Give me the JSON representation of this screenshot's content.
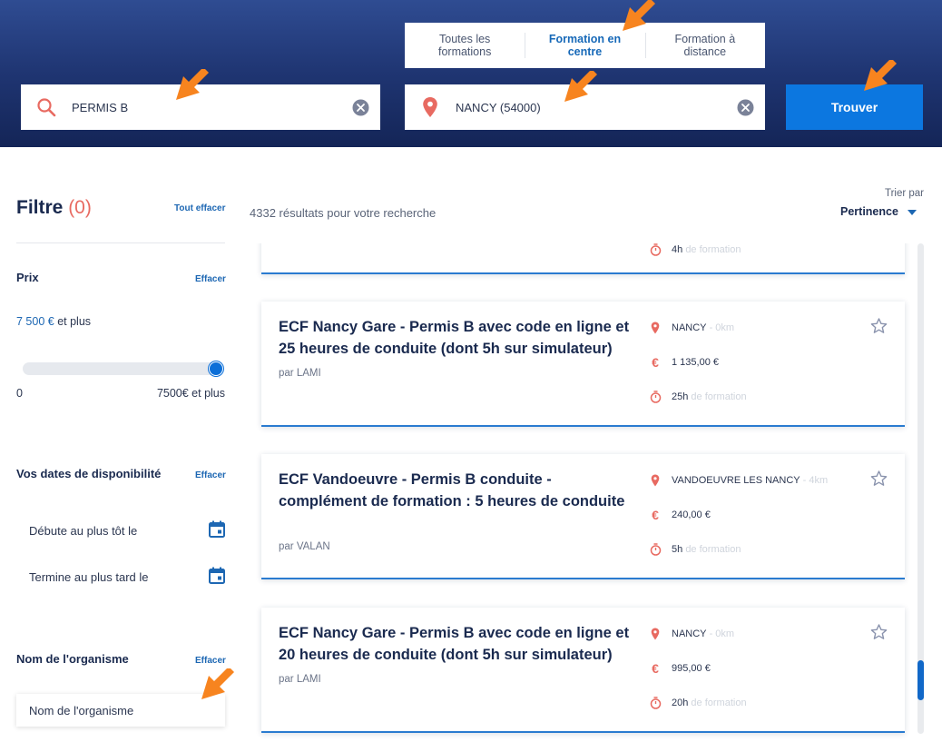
{
  "header": {
    "mode_tabs": [
      {
        "label": "Toutes les formations",
        "active": false
      },
      {
        "label": "Formation en centre",
        "active": true
      },
      {
        "label": "Formation à distance",
        "active": false
      }
    ],
    "search": {
      "value": "PERMIS B",
      "icon": "search-icon"
    },
    "location": {
      "value": "NANCY (54000)",
      "icon": "map-pin-icon"
    },
    "find_label": "Trouver"
  },
  "sidebar": {
    "filter_title": "Filtre",
    "filter_count": "(0)",
    "clear_all_label": "Tout effacer",
    "price": {
      "title": "Prix",
      "clear_label": "Effacer",
      "value_num": "7 500 €",
      "value_suffix": " et plus",
      "slider_min": "0",
      "slider_max": "7500€ et plus",
      "slider_position": 1.0
    },
    "dates": {
      "title": "Vos dates de disponibilité",
      "clear_label": "Effacer",
      "start_label": "Débute au plus tôt le",
      "end_label": "Termine au plus tard le"
    },
    "org": {
      "title": "Nom de l'organisme",
      "clear_label": "Effacer",
      "placeholder": "Nom de l'organisme"
    }
  },
  "results": {
    "count_text": "4332 résultats pour votre recherche",
    "sort_label": "Trier par",
    "sort_value": "Pertinence",
    "partial_card": {
      "duration": "4h",
      "duration_suffix": "de formation"
    },
    "cards": [
      {
        "title": "ECF Nancy Gare - Permis B avec code en ligne et 25 heures de conduite (dont 5h sur simulateur)",
        "org": "par LAMI",
        "location": "NANCY",
        "distance": "- 0km",
        "price": "1 135,00 €",
        "duration": "25h",
        "duration_suffix": "de formation"
      },
      {
        "title": "ECF Vandoeuvre - Permis B conduite - complément de formation : 5 heures de conduite",
        "org": "par VALAN",
        "location": "VANDOEUVRE LES NANCY",
        "distance": "- 4km",
        "price": "240,00 €",
        "duration": "5h",
        "duration_suffix": "de formation"
      },
      {
        "title": "ECF Nancy Gare - Permis B avec code en ligne et 20 heures de conduite (dont 5h sur simulateur)",
        "org": "par LAMI",
        "location": "NANCY",
        "distance": "- 0km",
        "price": "995,00 €",
        "duration": "20h",
        "duration_suffix": "de formation"
      }
    ]
  },
  "colors": {
    "header_dark": "#142557",
    "accent_blue": "#0c77e0",
    "brand_red": "#e86a61",
    "annotation_orange": "#f7841f"
  }
}
